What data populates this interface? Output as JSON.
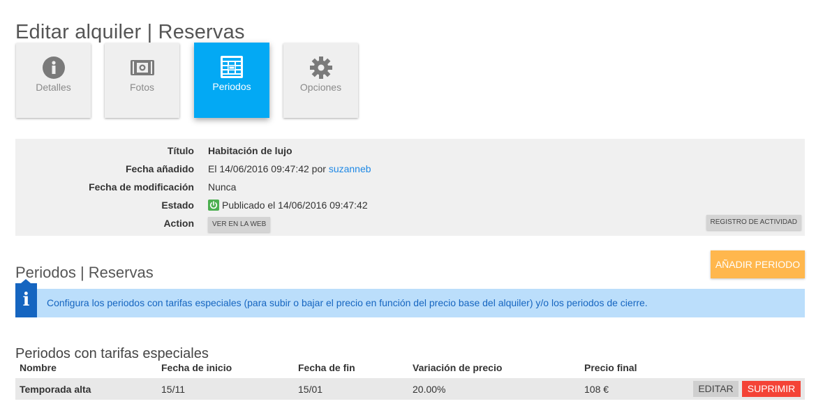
{
  "page": {
    "title": "Editar alquiler | Reservas"
  },
  "tabs": [
    {
      "label": "Detalles",
      "icon": "info-icon",
      "active": false
    },
    {
      "label": "Fotos",
      "icon": "camera-icon",
      "active": false
    },
    {
      "label": "Periodos",
      "icon": "calendar-table-icon",
      "active": true
    },
    {
      "label": "Opciones",
      "icon": "gear-icon",
      "active": false
    }
  ],
  "info": {
    "title_label": "Título",
    "title_value": "Habitación de lujo",
    "added_label": "Fecha añadido",
    "added_value": "El 14/06/2016 09:47:42 por",
    "added_user": "suzanneb",
    "modified_label": "Fecha de modificación",
    "modified_value": "Nunca",
    "status_label": "Estado",
    "status_value": "Publicado el 14/06/2016 09:47:42",
    "action_label": "Action",
    "view_web_button": "VER EN LA WEB",
    "activity_log_button": "REGISTRO DE ACTIVIDAD"
  },
  "section": {
    "title": "Periodos | Reservas",
    "add_button": "AÑADIR PERIODO"
  },
  "alert": {
    "message": "Configura los periodos con tarifas especiales (para subir o bajar el precio en función del precio base del alquiler) y/o los periodos de cierre."
  },
  "special_rates": {
    "title": "Periodos con tarifas especiales",
    "columns": [
      "Nombre",
      "Fecha de inicio",
      "Fecha de fin",
      "Variación de precio",
      "Precio final"
    ],
    "rows": [
      {
        "name": "Temporada alta",
        "start": "15/11",
        "end": "15/01",
        "variation": "20.00%",
        "final_price": "108 €"
      }
    ],
    "edit_button": "EDITAR",
    "delete_button": "SUPRIMIR"
  },
  "colors": {
    "active_tab": "#03a9f4",
    "add_button": "#ffb74d",
    "alert_bg": "#bbdefb",
    "alert_text": "#1565c0",
    "delete_button": "#f44336",
    "status_published": "#4caf50",
    "link": "#1e88e5"
  }
}
